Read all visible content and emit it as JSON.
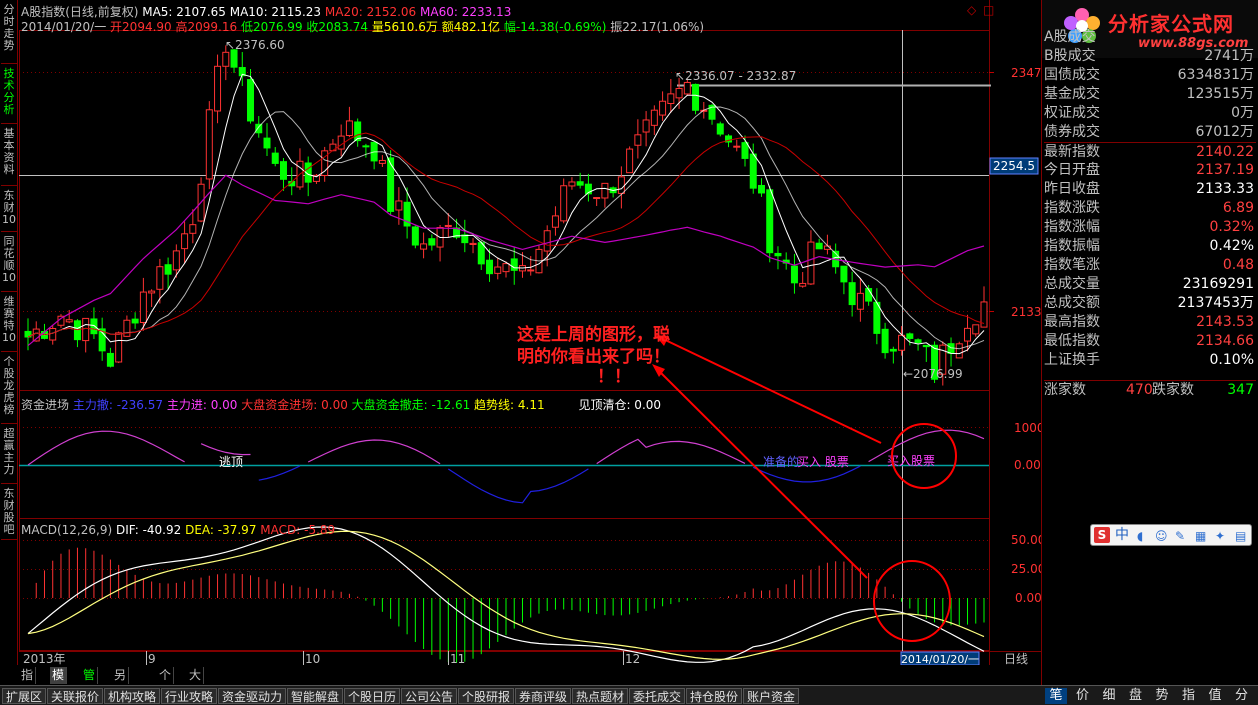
{
  "left_tabs": [
    "分时走势",
    "技术分析",
    "基本资料",
    "东财10",
    "同花顺10",
    "维赛特10",
    "个股龙虎榜",
    "超赢主力",
    "东财股吧"
  ],
  "left_tab_active": 1,
  "top_info": {
    "index_name": "A股指数(日线,前复权)",
    "ma5": "MA5: 2107.65",
    "ma10": "MA10: 2115.23",
    "ma20": "MA20: 2152.06",
    "ma60": "MA60: 2233.13",
    "date": "2014/01/20/一",
    "open": "开2094.90",
    "high": "高2099.16",
    "low": "低2076.99",
    "close": "收2083.74",
    "volume": "量5610.6万",
    "amount": "额482.1亿",
    "change": "幅-14.38(-0.69%)",
    "amplitude": "振22.17(1.06%)"
  },
  "price_axis": {
    "label_2347": "2347",
    "label_2254": "2254.5",
    "label_2133": "2133"
  },
  "price_annotations": {
    "high_left": "2376.60",
    "high_right": "2336.07 - 2332.87",
    "low": "2076.99"
  },
  "fund_indicator": {
    "title": "资金进场",
    "main_out": "主力撤: -236.57",
    "main_in": "主力进: 0.00",
    "big_in": "大盘资金进场: 0.00",
    "big_out": "大盘资金撤走: -12.61",
    "trend": "趋势线: 4.11",
    "top_signal": "见顶清仓: 0.00",
    "label_escape": "逃顶",
    "label_prepare": "准备的",
    "label_buy1": "买入 股票",
    "label_buy2": "买入股票",
    "axis_1000": "1000",
    "axis_0": "0.00"
  },
  "macd": {
    "title": "MACD(12,26,9)",
    "dif": "DIF: -40.92",
    "dea": "DEA: -37.97",
    "macd": "MACD: -5.89",
    "axis_50": "50.00",
    "axis_25": "25.00",
    "axis_0": "0.00"
  },
  "time_axis": {
    "t1": "2013年",
    "t2": "9",
    "t3": "10",
    "t4": "11",
    "t5": "12",
    "current": "2014/01/20/一",
    "period": "日线"
  },
  "annotation_text": {
    "line1": "这是上周的图形，聪",
    "line2": "明的你看出来了吗！",
    "line3": "！！"
  },
  "logo": {
    "title": "分析家公式网",
    "url": "www.88gs.com"
  },
  "stats": [
    {
      "label": "A股成交",
      "value": "",
      "color": "#c0c0c0"
    },
    {
      "label": "B股成交",
      "value": "2741万",
      "color": "#c0c0c0"
    },
    {
      "label": "国债成交",
      "value": "6334831万",
      "color": "#c0c0c0"
    },
    {
      "label": "基金成交",
      "value": "123515万",
      "color": "#c0c0c0"
    },
    {
      "label": "权证成交",
      "value": "0万",
      "color": "#c0c0c0"
    },
    {
      "label": "债券成交",
      "value": "67012万",
      "color": "#c0c0c0"
    },
    {
      "label": "最新指数",
      "value": "2140.22",
      "color": "#ff4040"
    },
    {
      "label": "今日开盘",
      "value": "2137.19",
      "color": "#ff4040"
    },
    {
      "label": "昨日收盘",
      "value": "2133.33",
      "color": "#ffffff"
    },
    {
      "label": "指数涨跌",
      "value": "6.89",
      "color": "#ff4040"
    },
    {
      "label": "指数涨幅",
      "value": "0.32%",
      "color": "#ff4040"
    },
    {
      "label": "指数振幅",
      "value": "0.42%",
      "color": "#ffffff"
    },
    {
      "label": "指数笔涨",
      "value": "0.48",
      "color": "#ff4040"
    },
    {
      "label": "总成交量",
      "value": "23169291",
      "color": "#ffffff"
    },
    {
      "label": "总成交额",
      "value": "2137453万",
      "color": "#ffffff"
    },
    {
      "label": "最高指数",
      "value": "2143.53",
      "color": "#ff4040"
    },
    {
      "label": "最低指数",
      "value": "2134.66",
      "color": "#ff4040"
    },
    {
      "label": "上证换手",
      "value": "0.10%",
      "color": "#ffffff"
    }
  ],
  "advance_decline": {
    "up_label": "涨家数",
    "up": "470",
    "down_label": "跌家数",
    "down": "347"
  },
  "bottom_tabs": [
    "指标",
    "模板",
    "管理",
    "另存为",
    "个股",
    "大盘"
  ],
  "menu": [
    "扩展区",
    "关联报价",
    "机构攻略",
    "行业攻略",
    "资金驱动力",
    "智能解盘",
    "个股日历",
    "公司公告",
    "个股研报",
    "券商评级",
    "热点题材",
    "委托成交",
    "持仓股份",
    "账户资金"
  ],
  "right_bottom": [
    "笔",
    "价",
    "细",
    "盘",
    "势",
    "指",
    "值",
    "分"
  ],
  "ime": {
    "s": "S",
    "cn": "中"
  },
  "colors": {
    "up": "#ff3232",
    "down": "#00ff00",
    "ma5": "#ffffff",
    "ma20": "#c80000",
    "ma60": "#c000c0",
    "border": "#800000"
  }
}
